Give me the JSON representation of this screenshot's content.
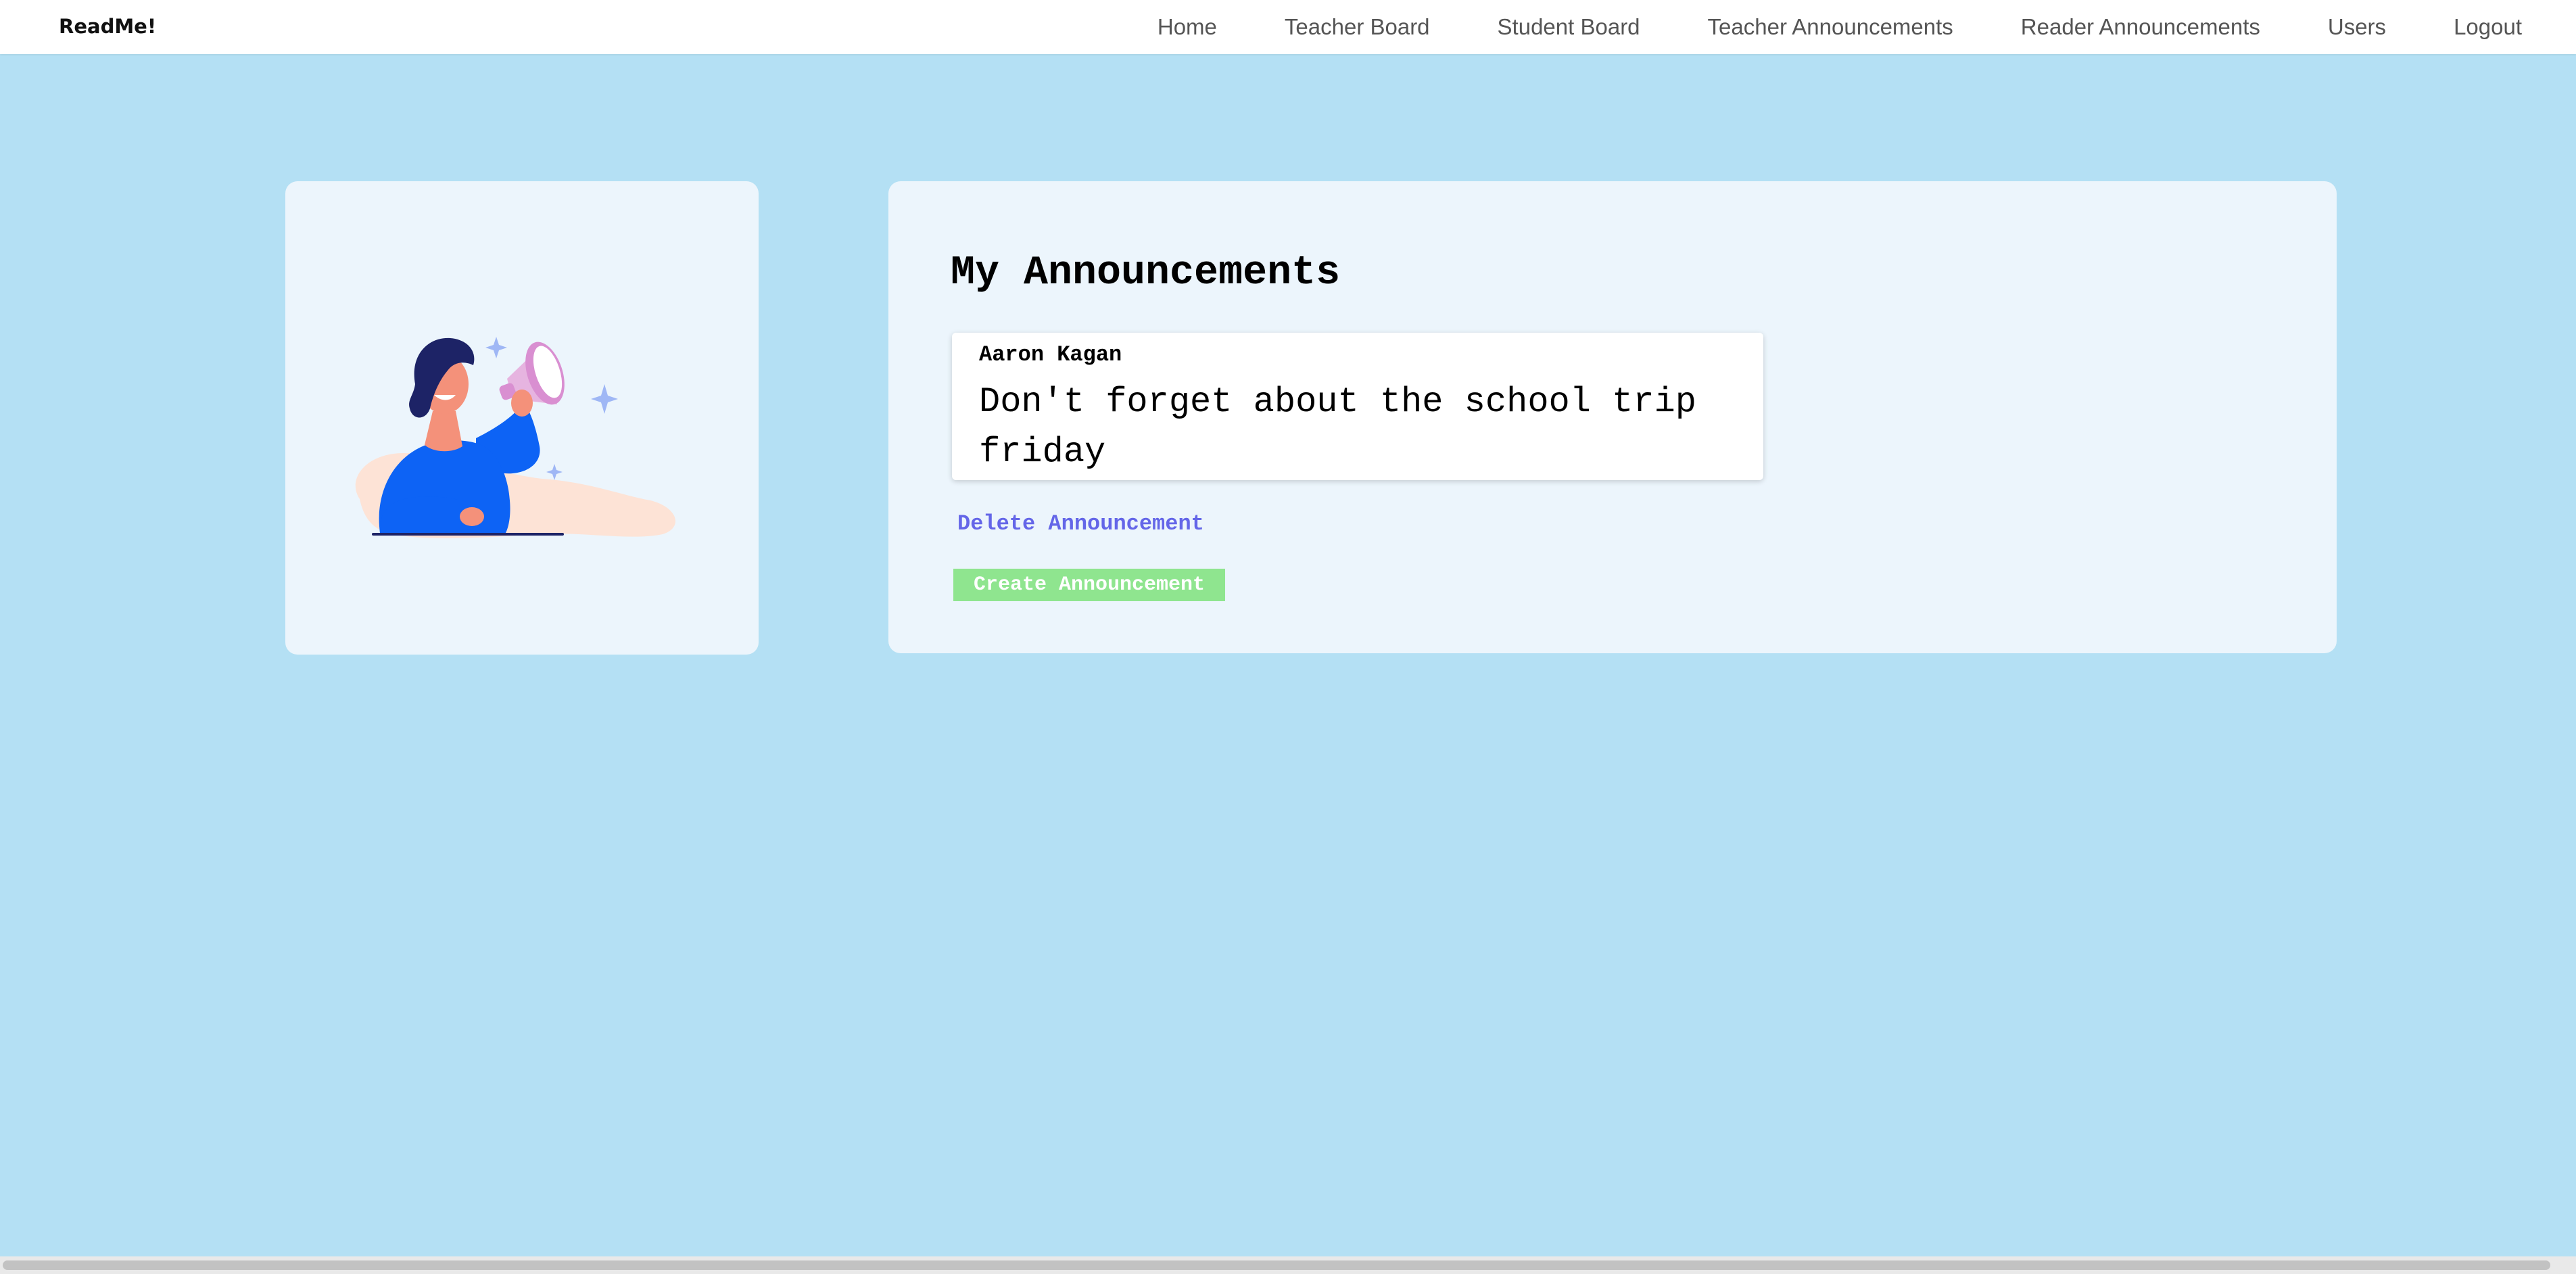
{
  "brand": "ReadMe!",
  "nav": {
    "items": [
      "Home",
      "Teacher Board",
      "Student Board",
      "Teacher Announcements",
      "Reader Announcements",
      "Users",
      "Logout"
    ]
  },
  "illustration": {
    "icon": "woman-with-megaphone-illustration",
    "colors": {
      "shirt": "#0d63f5",
      "skin": "#f4917a",
      "hair": "#1d2366",
      "megaphone": "#e6b4e0",
      "sparkle": "#9fb7f5",
      "blob": "#fde3d6"
    }
  },
  "main": {
    "title": "My Announcements",
    "announcements": [
      {
        "author": "Aaron Kagan",
        "text": "Don't forget about the school trip friday"
      }
    ],
    "delete_label": "Delete Announcement",
    "create_label": "Create Announcement"
  },
  "colors": {
    "page_background": "#b4e0f4",
    "card_background": "#ecf5fc",
    "link": "#6466e8",
    "create_button": "#8fe58f"
  }
}
